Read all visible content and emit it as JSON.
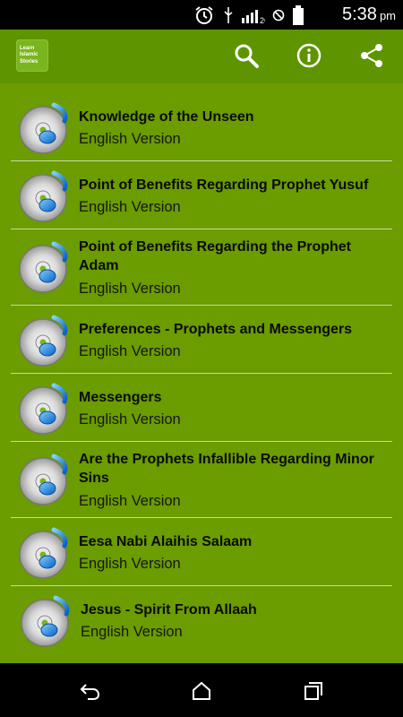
{
  "status_bar": {
    "time": "5:38",
    "ampm": "pm",
    "icons": [
      "alarm-icon",
      "usb-icon",
      "signal-icon",
      "blocked-icon",
      "battery-icon"
    ]
  },
  "app_bar": {
    "logo_lines": [
      "Learn",
      "Islamic",
      "Stories"
    ],
    "actions": [
      "search-icon",
      "info-icon",
      "share-icon"
    ]
  },
  "list": {
    "items": [
      {
        "title": "Knowledge of the Unseen",
        "subtitle": "English Version"
      },
      {
        "title": "Point of Benefits Regarding Prophet Yusuf",
        "subtitle": "English Version"
      },
      {
        "title": "Point of Benefits Regarding the Prophet Adam",
        "subtitle": "English Version"
      },
      {
        "title": "Preferences - Prophets and Messengers",
        "subtitle": "English Version"
      },
      {
        "title": "Messengers",
        "subtitle": "English Version"
      },
      {
        "title": "Are the Prophets Infallible Regarding Minor Sins",
        "subtitle": "English Version"
      },
      {
        "title": "Eesa Nabi Alaihis Salaam",
        "subtitle": "English Version"
      },
      {
        "title": "Jesus - Spirit From Allaah",
        "subtitle": "English Version"
      }
    ]
  },
  "colors": {
    "app_bar": "#5e9400",
    "list_background": "#6b9c00",
    "divider": "#c8dca0"
  },
  "nav_bar": [
    "back-icon",
    "home-icon",
    "recents-icon"
  ]
}
